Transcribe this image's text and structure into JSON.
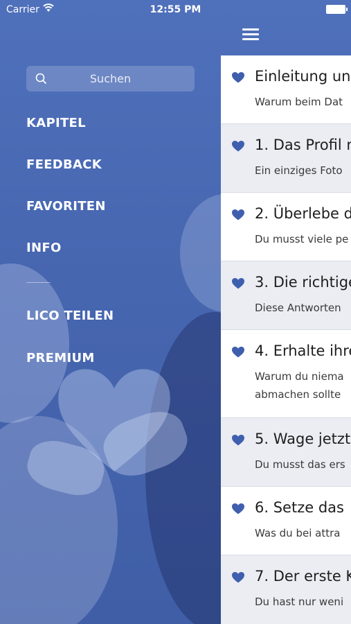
{
  "status_bar": {
    "carrier": "Carrier",
    "time": "12:55 PM"
  },
  "sidebar": {
    "search_placeholder": "Suchen",
    "items": [
      {
        "label": "KAPITEL"
      },
      {
        "label": "FEEDBACK"
      },
      {
        "label": "FAVORITEN"
      },
      {
        "label": "INFO"
      },
      {
        "label": "LICO TEILEN"
      },
      {
        "label": "PREMIUM"
      }
    ]
  },
  "colors": {
    "brand": "#4a6bb5",
    "heart": "#3f5fae"
  },
  "chapters": [
    {
      "title": "Einleitung un",
      "lines": [
        "Warum beim Dat"
      ]
    },
    {
      "title": "1. Das Profil n",
      "lines": [
        "Ein einziges Foto"
      ]
    },
    {
      "title": "2. Überlebe d",
      "lines": [
        "Du musst viele pe"
      ]
    },
    {
      "title": "3. Die richtige",
      "lines": [
        "Diese Antworten"
      ]
    },
    {
      "title": "4. Erhalte ihre",
      "lines": [
        "Warum du niema",
        "abmachen sollte"
      ]
    },
    {
      "title": "5. Wage jetzt",
      "lines": [
        "Du musst das ers"
      ]
    },
    {
      "title": "6. Setze das",
      "lines": [
        "Was du bei attra"
      ]
    },
    {
      "title": "7. Der erste K",
      "lines": [
        "Du hast nur weni"
      ]
    }
  ]
}
